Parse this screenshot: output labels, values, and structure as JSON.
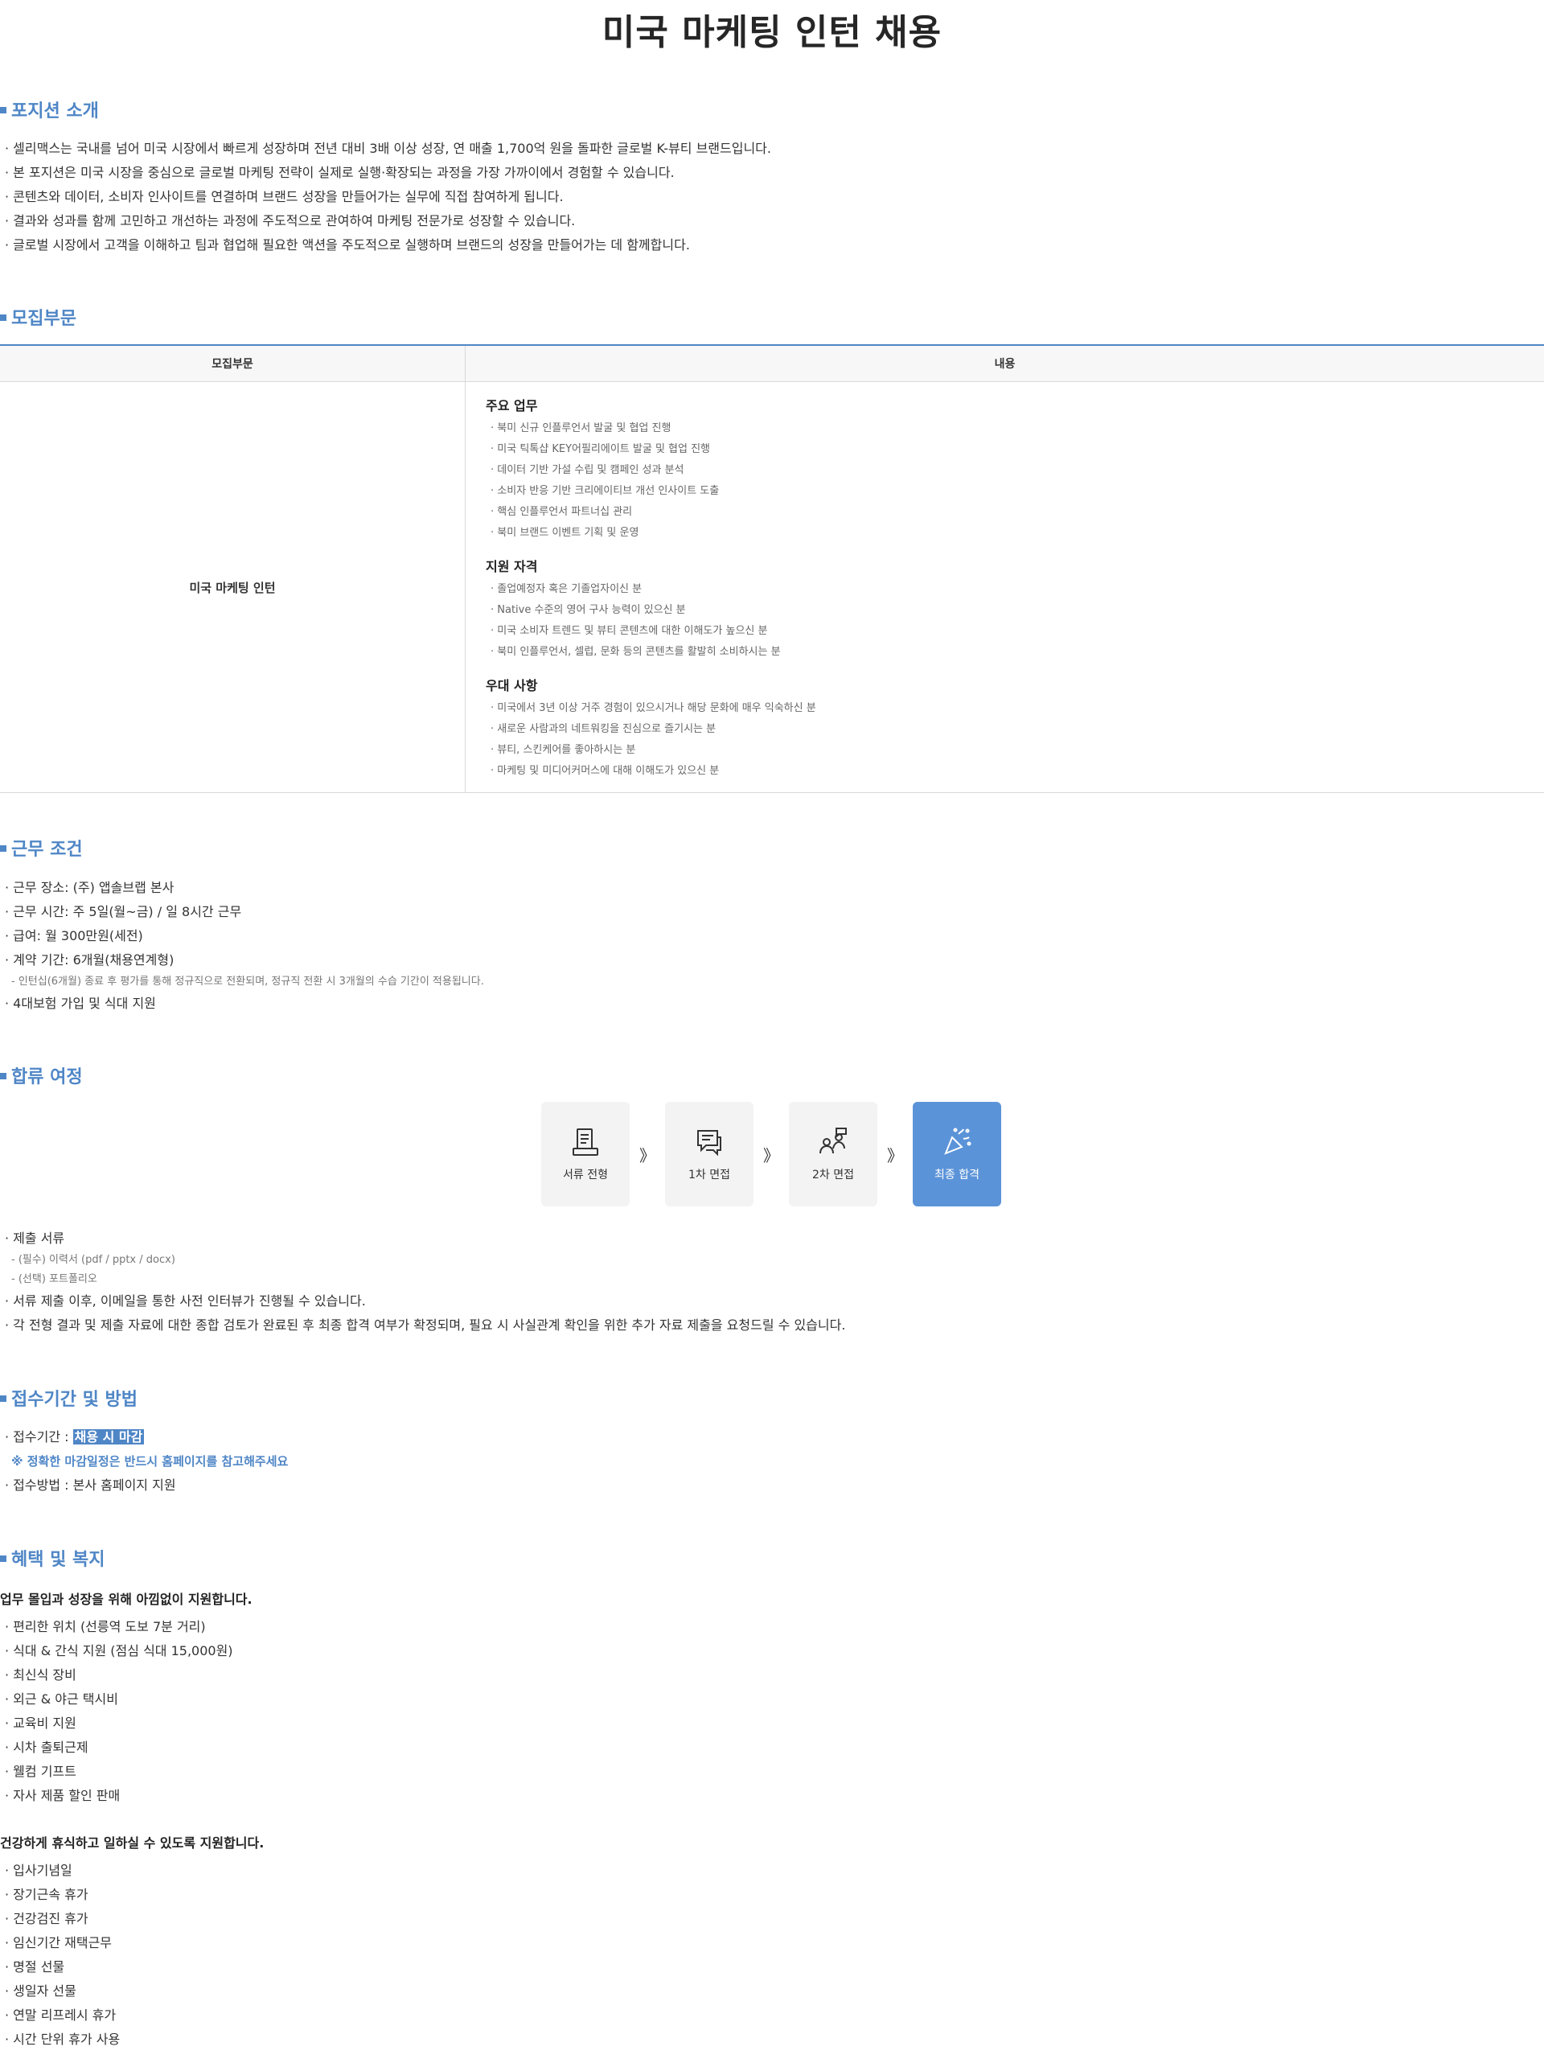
{
  "title": "미국 마케팅 인턴 채용",
  "position_intro": {
    "heading": "포지션 소개",
    "items": [
      "· 셀리맥스는 국내를 넘어 미국 시장에서 빠르게 성장하며 전년 대비 3배 이상 성장, 연 매출 1,700억 원을 돌파한 글로벌 K-뷰티 브랜드입니다.",
      "· 본 포지션은 미국 시장을 중심으로 글로벌 마케팅 전략이 실제로 실행·확장되는 과정을 가장 가까이에서 경험할 수 있습니다.",
      "· 콘텐츠와 데이터, 소비자 인사이트를 연결하며 브랜드 성장을 만들어가는 실무에 직접 참여하게 됩니다.",
      "· 결과와 성과를 함께 고민하고 개선하는 과정에 주도적으로 관여하여 마케팅 전문가로 성장할 수 있습니다.",
      "· 글로벌 시장에서 고객을 이해하고 팀과 협업해 필요한 액션을 주도적으로 실행하며 브랜드의 성장을 만들어가는 데 함께합니다."
    ]
  },
  "recruit": {
    "heading": "모집부문",
    "col_position": "모집부문",
    "col_content": "내용",
    "position_name": "미국 마케팅 인턴",
    "duties_title": "주요 업무",
    "duties": [
      "· 북미 신규 인플루언서 발굴 및 협업 진행",
      "· 미국 틱톡샵 KEY어필리에이트 발굴 및 협업 진행",
      "· 데이터 기반 가설 수립 및 캠페인 성과 분석",
      "· 소비자 반응 기반 크리에이티브 개선 인사이트 도출",
      "· 핵심 인플루언서 파트너십 관리",
      "· 북미 브랜드 이벤트 기획 및 운영"
    ],
    "qual_title": "지원 자격",
    "quals": [
      "· 졸업예정자 혹은 기졸업자이신 분",
      "· Native 수준의 영어 구사 능력이 있으신 분",
      "· 미국 소비자 트렌드 및 뷰티 콘텐츠에 대한 이해도가 높으신 분",
      "· 북미 인플루언서, 셀럽, 문화 등의 콘텐츠를 활발히 소비하시는 분"
    ],
    "pref_title": "우대 사항",
    "prefs": [
      "· 미국에서 3년 이상 거주 경험이 있으시거나 해당 문화에 매우 익숙하신 분",
      "· 새로운 사람과의 네트워킹을 진심으로 즐기시는 분",
      "· 뷰티, 스킨케어를 좋아하시는 분",
      "· 마케팅 및 미디어커머스에 대해 이해도가 있으신 분"
    ]
  },
  "work": {
    "heading": "근무 조건",
    "location": "· 근무 장소: (주) 앱솔브랩 본사",
    "hours": "· 근무 시간: 주 5일(월~금) / 일 8시간 근무",
    "salary": "· 급여: 월 300만원(세전)",
    "period": "· 계약 기간: 6개월(채용연계형)",
    "period_note": "- 인턴십(6개월) 종료 후 평가를 통해 정규직으로 전환되며, 정규직 전환 시 3개월의 수습 기간이 적용됩니다.",
    "insurance": "· 4대보험 가입 및 식대 지원"
  },
  "process": {
    "heading": "합류 여정",
    "steps": [
      "서류 전형",
      "1차 면접",
      "2차 면접",
      "최종 합격"
    ],
    "arrow": "》",
    "docs": "· 제출 서류",
    "docs_required": "- (필수) 이력서 (pdf / pptx / docx)",
    "docs_optional": "- (선택) 포트폴리오",
    "note1": "· 서류 제출 이후, 이메일을 통한 사전 인터뷰가 진행될 수 있습니다.",
    "note2": "· 각 전형 결과 및 제출 자료에 대한 종합 검토가 완료된 후 최종 합격 여부가 확정되며, 필요 시 사실관계 확인을 위한 추가 자료 제출을 요청드릴 수 있습니다."
  },
  "apply": {
    "heading": "접수기간 및 방법",
    "period_label": "· 접수기간 : ",
    "period_value": "채용 시 마감",
    "notice": "※ 정확한 마감일정은 반드시 홈페이지를 참고해주세요",
    "method": "· 접수방법 : 본사 홈페이지 지원"
  },
  "benefits": {
    "heading": "혜택 및 복지",
    "group1_title": "업무 몰입과 성장을 위해 아낌없이 지원합니다.",
    "group1": [
      "· 편리한 위치 (선릉역 도보 7분 거리)",
      "· 식대 & 간식 지원 (점심 식대 15,000원)",
      "· 최신식 장비",
      "· 외근 & 야근 택시비",
      "· 교육비 지원",
      "· 시차 출퇴근제",
      "· 웰컴 기프트",
      "· 자사 제품 할인 판매"
    ],
    "group2_title": "건강하게 휴식하고 일하실 수 있도록 지원합니다.",
    "group2": [
      "· 입사기념일",
      "· 장기근속 휴가",
      "· 건강검진 휴가",
      "· 임신기간 재택근무",
      "· 명절 선물",
      "· 생일자 선물",
      "· 연말 리프레시 휴가",
      "· 시간 단위 휴가 사용"
    ]
  },
  "colors": {
    "accent": "#4f86c6",
    "active_step": "#5b93d8"
  }
}
